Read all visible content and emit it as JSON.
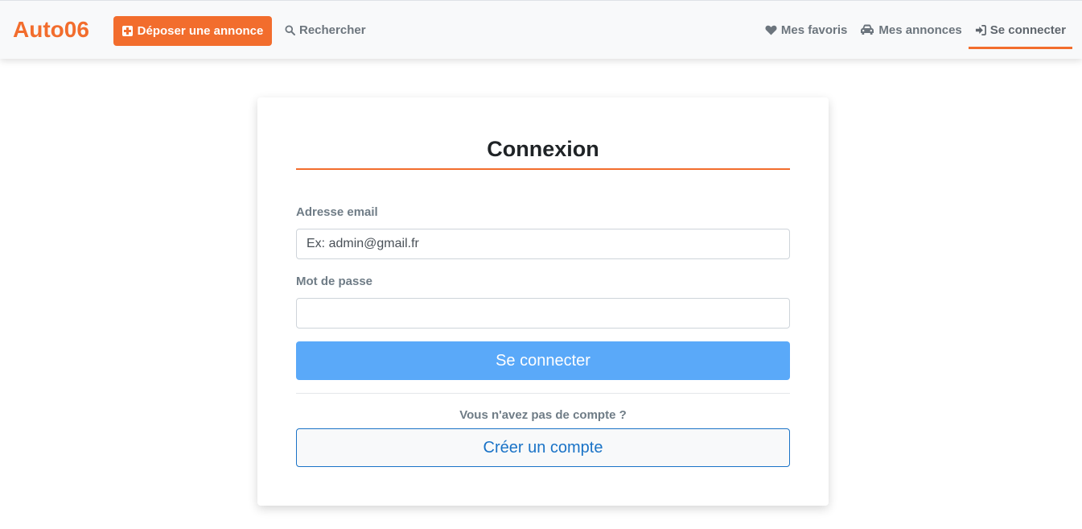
{
  "colors": {
    "accent": "#f26d2d",
    "primary_button": "#5aa9f9",
    "outline_button": "#1a73c7"
  },
  "navbar": {
    "brand": "Auto06",
    "post_button_label": "Déposer une annonce",
    "post_button_icon": "plus-square-icon",
    "search_label": "Rechercher",
    "search_icon": "search-icon",
    "items": [
      {
        "label": "Mes favoris",
        "icon": "heart-icon"
      },
      {
        "label": "Mes annonces",
        "icon": "car-icon"
      },
      {
        "label": "Se connecter",
        "icon": "sign-in-icon",
        "active": true
      }
    ]
  },
  "login": {
    "title": "Connexion",
    "email_label": "Adresse email",
    "email_placeholder": "Ex: admin@gmail.fr",
    "email_value": "",
    "password_label": "Mot de passe",
    "password_value": "",
    "submit_label": "Se connecter",
    "no_account_text": "Vous n'avez pas de compte ?",
    "create_account_label": "Créer un compte"
  }
}
